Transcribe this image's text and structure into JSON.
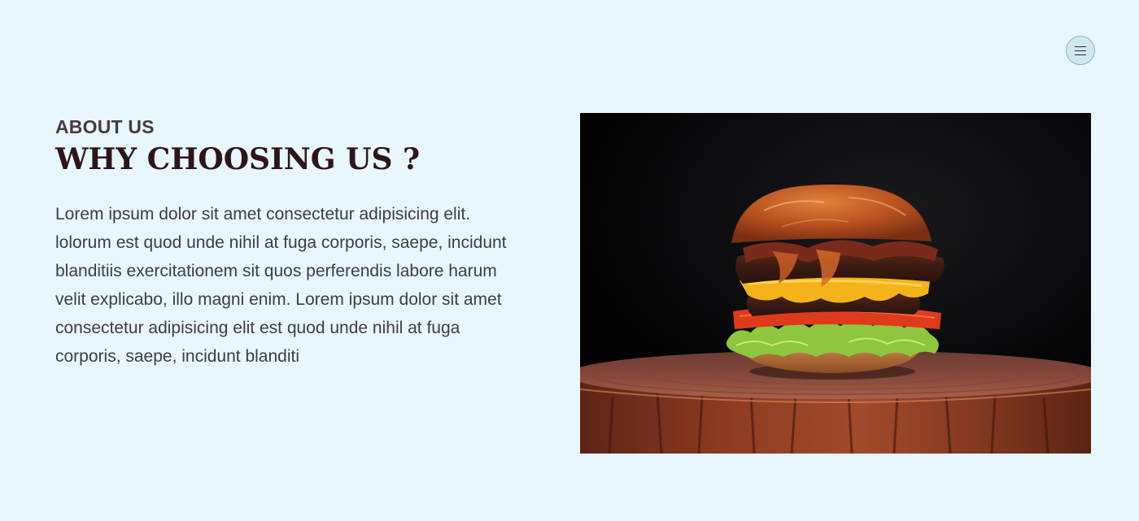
{
  "header": {
    "menu_icon": "hamburger-menu-icon"
  },
  "about": {
    "eyebrow": "ABOUT US",
    "heading": "WHY CHOOSING US ?",
    "body": "Lorem ipsum dolor sit amet consectetur adipisicing elit. lolorum est quod unde nihil at fuga corporis, saepe, incidunt blanditiis exercitationem sit quos perferendis labore harum velit explicabo, illo magni enim. Lorem ipsum dolor sit amet consectetur adipisicing elit est quod unde nihil at fuga corporis, saepe, incidunt blanditi"
  },
  "image": {
    "subject": "burger-on-wood-stump"
  },
  "colors": {
    "background": "#e8f6fe",
    "heading": "#2d1519",
    "eyebrow": "#4a3a3d",
    "body": "#3d3d45"
  }
}
